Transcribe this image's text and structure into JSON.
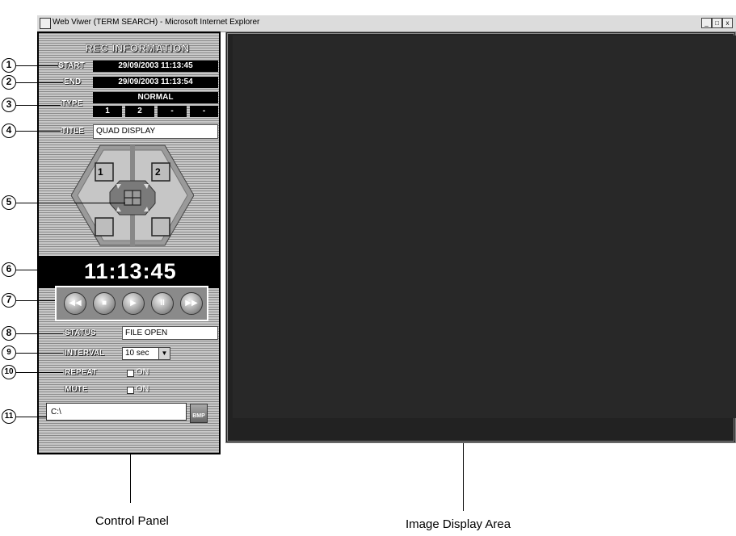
{
  "window": {
    "title": "Web Viwer (TERM SEARCH) - Microsoft Internet Explorer",
    "min_btn": "_",
    "max_btn": "□",
    "close_btn": "x"
  },
  "panel": {
    "title": "REC INFORMATION",
    "start_label": "START",
    "start_value": "29/09/2003 11:13:45",
    "end_label": "END",
    "end_value": "29/09/2003 11:13:54",
    "type_label": "TYPE",
    "type_value": "NORMAL",
    "type_cells": [
      "1",
      "2",
      "-",
      "-"
    ],
    "title_label": "TITLE",
    "title_value": "QUAD DISPLAY",
    "camera_1": "1",
    "camera_2": "2",
    "time": "11:13:45",
    "status_label": "STATUS",
    "status_value": "FILE OPEN",
    "interval_label": "INTERVAL",
    "interval_value": "10 sec",
    "repeat_label": "REPEAT",
    "repeat_on": "ON",
    "mute_label": "MUTE",
    "mute_on": "ON",
    "path_value": "C:\\",
    "bmp_label": "BMP"
  },
  "playback": {
    "rewind": "◀◀",
    "stop": "■",
    "play": "▶",
    "pause": "II",
    "forward": "▶▶"
  },
  "callouts": [
    "1",
    "2",
    "3",
    "4",
    "5",
    "6",
    "7",
    "8",
    "9",
    "10",
    "11"
  ],
  "captions": {
    "control_panel": "Control Panel",
    "image_display_area": "Image Display Area"
  }
}
